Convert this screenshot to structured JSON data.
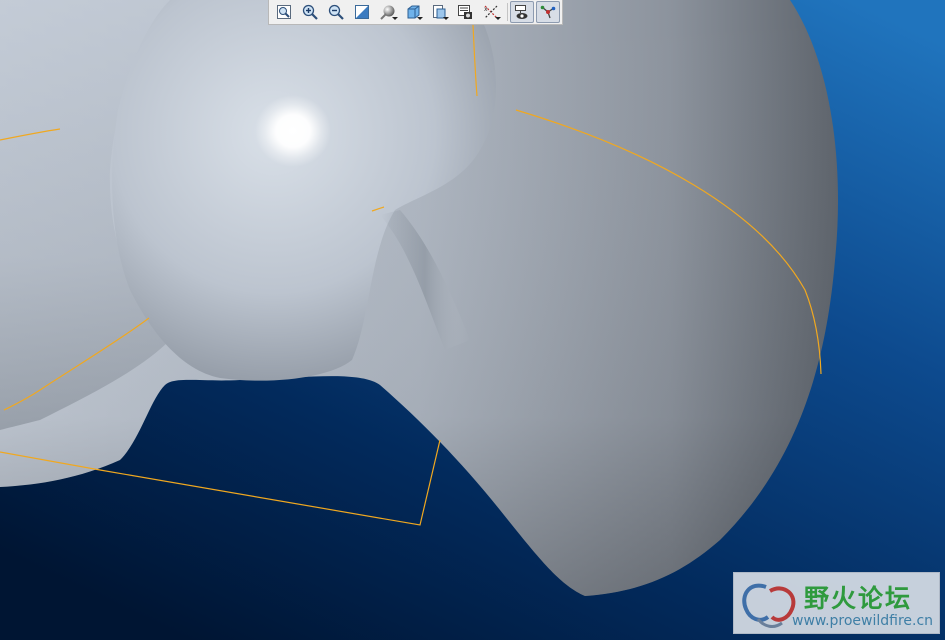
{
  "app": "3D CAD model viewport",
  "viewport": {
    "background_top_color": "#1f6fb8",
    "background_bottom_color": "#001533",
    "model_color": "#b2bac5",
    "edge_color": "#f0a820"
  },
  "toolbar": {
    "buttons": [
      {
        "icon": "zoom-fit-icon",
        "has_dropdown": false
      },
      {
        "icon": "zoom-in-icon",
        "has_dropdown": false
      },
      {
        "icon": "zoom-out-icon",
        "has_dropdown": false
      },
      {
        "icon": "reorient-icon",
        "has_dropdown": false
      },
      {
        "icon": "shading-style-icon",
        "has_dropdown": true
      },
      {
        "icon": "saved-views-icon",
        "has_dropdown": true
      },
      {
        "icon": "view-manager-icon",
        "has_dropdown": true
      },
      {
        "icon": "display-style-icon",
        "has_dropdown": false
      },
      {
        "icon": "datum-display-icon",
        "has_dropdown": true
      },
      {
        "icon": "annotation-display-icon",
        "has_dropdown": false,
        "pressed": true
      },
      {
        "icon": "spin-center-icon",
        "has_dropdown": false,
        "pressed": true
      }
    ]
  },
  "watermark": {
    "title": "野火论坛",
    "url": "www.proewildfire.cn",
    "title_color": "#2f9a3e",
    "url_color": "#3f7fa6"
  }
}
